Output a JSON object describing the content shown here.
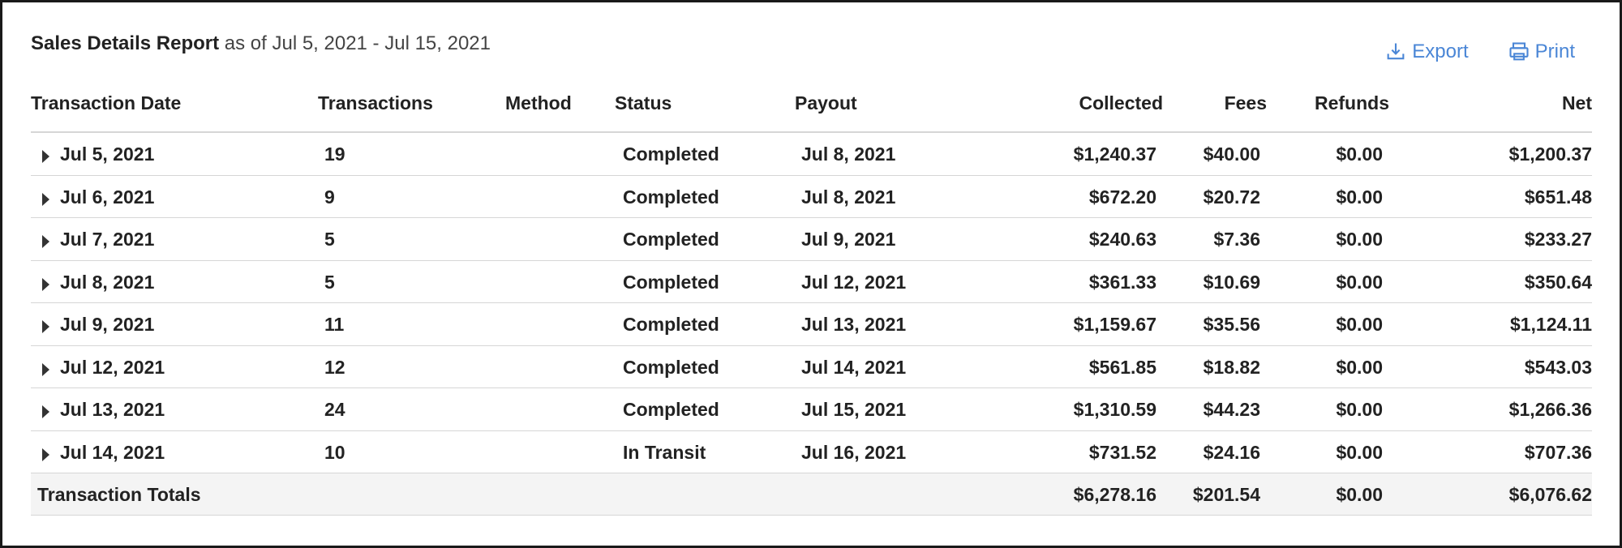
{
  "report": {
    "title": "Sales Details Report",
    "subtitle": "as of Jul 5, 2021 - Jul 15, 2021"
  },
  "actions": {
    "export_label": "Export",
    "print_label": "Print"
  },
  "columns": {
    "date": "Transaction Date",
    "transactions": "Transactions",
    "method": "Method",
    "status": "Status",
    "payout": "Payout",
    "collected": "Collected",
    "fees": "Fees",
    "refunds": "Refunds",
    "net": "Net"
  },
  "rows": [
    {
      "date": "Jul 5, 2021",
      "transactions": "19",
      "method": "",
      "status": "Completed",
      "payout": "Jul 8, 2021",
      "collected": "$1,240.37",
      "fees": "$40.00",
      "refunds": "$0.00",
      "net": "$1,200.37"
    },
    {
      "date": "Jul 6, 2021",
      "transactions": "9",
      "method": "",
      "status": "Completed",
      "payout": "Jul 8, 2021",
      "collected": "$672.20",
      "fees": "$20.72",
      "refunds": "$0.00",
      "net": "$651.48"
    },
    {
      "date": "Jul 7, 2021",
      "transactions": "5",
      "method": "",
      "status": "Completed",
      "payout": "Jul 9, 2021",
      "collected": "$240.63",
      "fees": "$7.36",
      "refunds": "$0.00",
      "net": "$233.27"
    },
    {
      "date": "Jul 8, 2021",
      "transactions": "5",
      "method": "",
      "status": "Completed",
      "payout": "Jul 12, 2021",
      "collected": "$361.33",
      "fees": "$10.69",
      "refunds": "$0.00",
      "net": "$350.64"
    },
    {
      "date": "Jul 9, 2021",
      "transactions": "11",
      "method": "",
      "status": "Completed",
      "payout": "Jul 13, 2021",
      "collected": "$1,159.67",
      "fees": "$35.56",
      "refunds": "$0.00",
      "net": "$1,124.11"
    },
    {
      "date": "Jul 12, 2021",
      "transactions": "12",
      "method": "",
      "status": "Completed",
      "payout": "Jul 14, 2021",
      "collected": "$561.85",
      "fees": "$18.82",
      "refunds": "$0.00",
      "net": "$543.03"
    },
    {
      "date": "Jul 13, 2021",
      "transactions": "24",
      "method": "",
      "status": "Completed",
      "payout": "Jul 15, 2021",
      "collected": "$1,310.59",
      "fees": "$44.23",
      "refunds": "$0.00",
      "net": "$1,266.36"
    },
    {
      "date": "Jul 14, 2021",
      "transactions": "10",
      "method": "",
      "status": "In Transit",
      "payout": "Jul 16, 2021",
      "collected": "$731.52",
      "fees": "$24.16",
      "refunds": "$0.00",
      "net": "$707.36"
    }
  ],
  "totals": {
    "label": "Transaction Totals",
    "collected": "$6,278.16",
    "fees": "$201.54",
    "refunds": "$0.00",
    "net": "$6,076.62"
  },
  "colors": {
    "accent": "#4a86d6",
    "border": "#d6d6d6",
    "totals_bg": "#f4f4f4"
  },
  "icons": {
    "export": "export-icon",
    "print": "printer-icon",
    "expand": "caret-right-icon"
  }
}
